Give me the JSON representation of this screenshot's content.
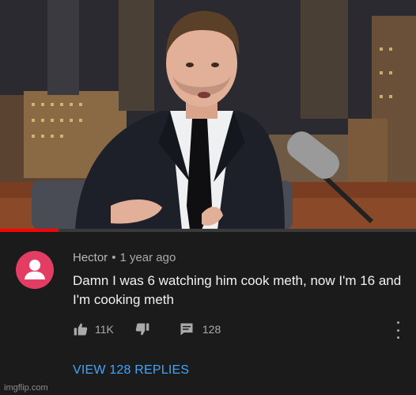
{
  "video": {
    "progress_fraction": 0.14
  },
  "comment": {
    "author": "Hector",
    "separator": "•",
    "time": "1 year ago",
    "text": "Damn I was 6 watching him cook meth, now I'm 16 and I'm cooking meth",
    "likes": "11K",
    "reply_count": "128",
    "view_replies": "VIEW 128 REPLIES",
    "avatar_color": "#e33d64"
  },
  "icons": [
    "thumbs-up-icon",
    "thumbs-down-icon",
    "reply-icon",
    "more-vertical-icon",
    "default-avatar-icon"
  ],
  "watermark": "imgflip.com"
}
